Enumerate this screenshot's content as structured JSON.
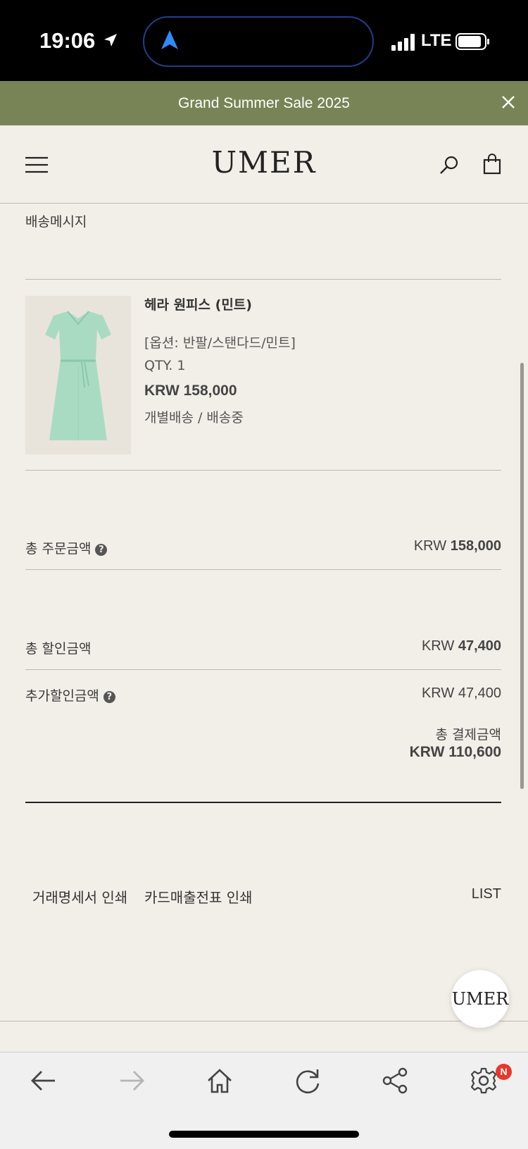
{
  "status_bar": {
    "time": "19:06",
    "network": "LTE"
  },
  "banner": {
    "text": "Grand Summer Sale 2025",
    "close_icon": "close-icon",
    "background_color": "#788455"
  },
  "header": {
    "logo": "UMER",
    "icons": [
      "menu-icon",
      "search-icon",
      "bag-icon"
    ]
  },
  "order": {
    "shipping_message_label": "배송메시지",
    "product": {
      "name": "헤라 원피스 (민트)",
      "option": "[옵션: 반팔/스탠다드/민트]",
      "qty": "QTY. 1",
      "price": "KRW 158,000",
      "status": "개별배송 / 배송중"
    },
    "summary": {
      "total_order_label": "총 주문금액",
      "total_order_currency": "KRW",
      "total_order_value": "158,000",
      "total_discount_label": "총 할인금액",
      "total_discount_currency": "KRW",
      "total_discount_value": "47,400",
      "extra_discount_label": "추가할인금액",
      "extra_discount_amount": "KRW 47,400",
      "payment_label": "총 결제금액",
      "payment_amount": "KRW 110,600"
    }
  },
  "links": {
    "statement_print": "거래명세서 인쇄",
    "card_receipt_print": "카드매출전표 인쇄",
    "list": "LIST"
  },
  "chat_button": {
    "label": "UMER"
  },
  "toolbar": {
    "icons": [
      "back-arrow-icon",
      "forward-arrow-icon",
      "home-icon",
      "refresh-icon",
      "share-icon",
      "settings-icon"
    ],
    "notification_badge": "N"
  }
}
